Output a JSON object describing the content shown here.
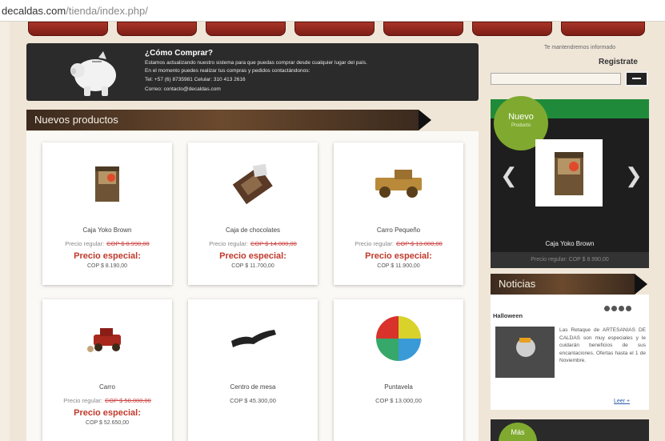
{
  "browser": {
    "domain": "decaldas.com",
    "path": "/tienda/index.php/"
  },
  "nav": {
    "tabs": [
      "",
      "",
      "",
      "",
      "",
      "",
      ""
    ]
  },
  "banner": {
    "title": "¿Cómo Comprar?",
    "lines": [
      "Estamos actualizando nuestro sistema para que puedas comprar desde cualquier lugar del país.",
      "En el momento puedes realizar tus compras y pedidos contactándonos:",
      "Tel: +57 (6) 8735981 Celular: 310 413 2616",
      "Correo: contacto@decaldas.com"
    ]
  },
  "sections": {
    "new_products": "Nuevos productos",
    "news": "Noticias"
  },
  "products": [
    {
      "name": "Caja Yoko Brown",
      "regular_label": "Precio regular:",
      "regular_price": "COP $ 8.990,00",
      "special_label": "Precio especial:",
      "special_price": "COP $ 8.190,00"
    },
    {
      "name": "Caja de chocolates",
      "regular_label": "Precio regular:",
      "regular_price": "COP $ 14.000,00",
      "special_label": "Precio especial:",
      "special_price": "COP $ 11.700,00"
    },
    {
      "name": "Carro Pequeño",
      "regular_label": "Precio regular:",
      "regular_price": "COP $ 13.000,00",
      "special_label": "Precio especial:",
      "special_price": "COP $ 11.900,00"
    },
    {
      "name": "Carro",
      "regular_label": "Precio regular:",
      "regular_price": "COP $ 58.000,00",
      "special_label": "Precio especial:",
      "special_price": "COP $ 52.650,00"
    },
    {
      "name": "Centro de mesa",
      "price": "COP $ 45.300,00"
    },
    {
      "name": "Puntavela",
      "price": "COP $ 13.000,00"
    }
  ],
  "sidebar": {
    "info": "Te mantendremos informado",
    "register_label": "Registrate",
    "register_placeholder": "",
    "new_badge_title": "Nuevo",
    "new_badge_sub": "Producto",
    "featured_name": "Caja Yoko Brown",
    "featured_price": "Precio regular: COP $ 8.990,00",
    "news_title": "Halloween",
    "news_text": "Las Retaque de ARTESANIAS DE CALDAS son muy especiales y le cuidarán beneficios de sus encantaciones. Ofertas hasta el 1 de Noviembre.",
    "news_more": "Leer +",
    "mas_label": "Más"
  },
  "colors": {
    "nav_red": "#8e2519",
    "sidebar_green": "#1f8b3a",
    "badge_green": "#7faa2f",
    "special_red": "#c0392b"
  }
}
